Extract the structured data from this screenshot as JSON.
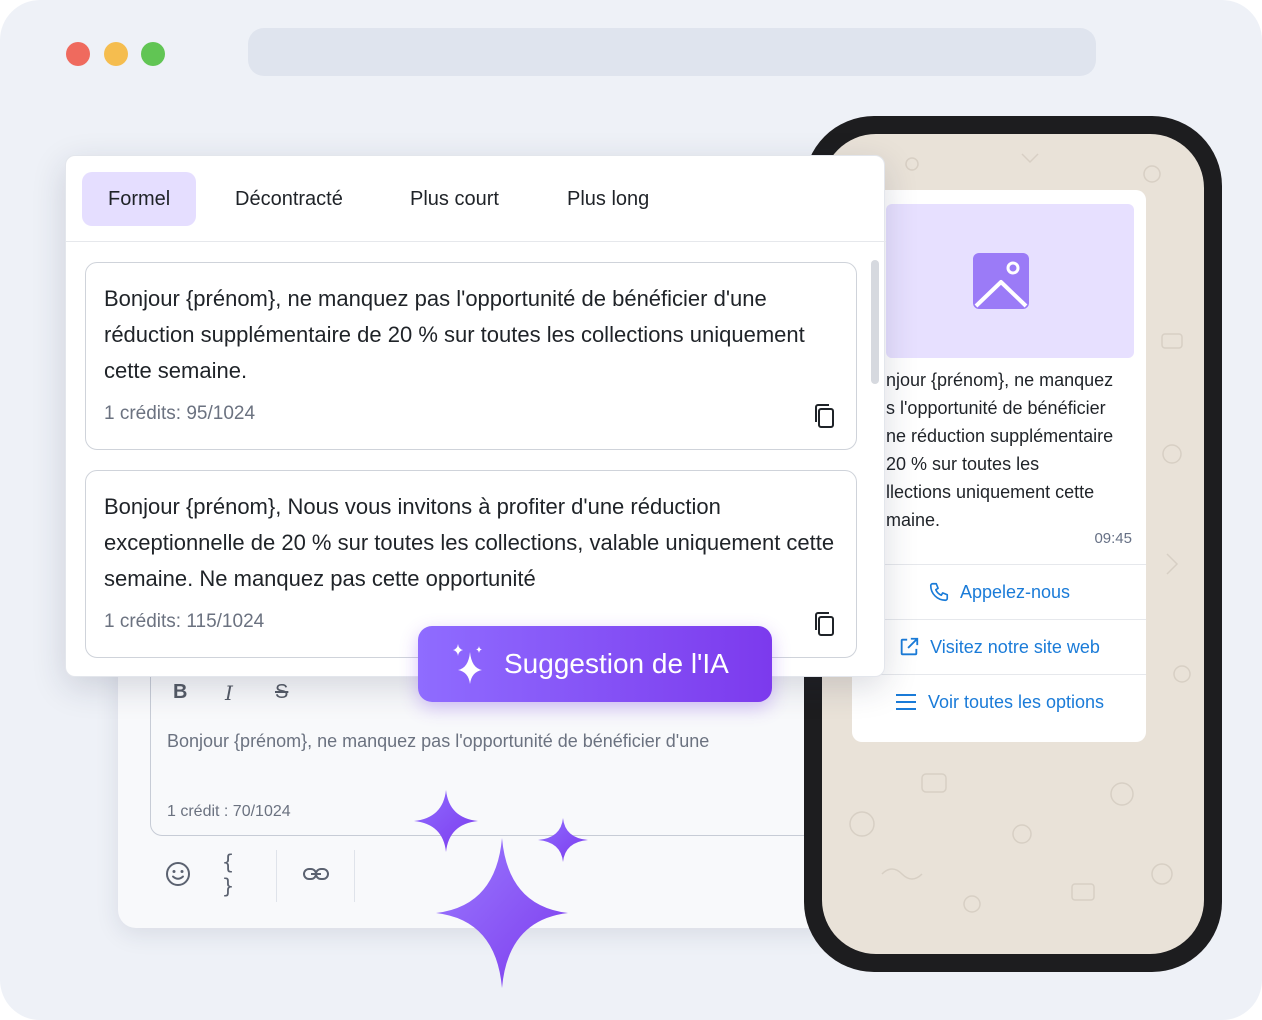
{
  "window": {
    "controls": [
      "close",
      "minimize",
      "maximize"
    ],
    "accent": "#7c3aed"
  },
  "tabs": [
    {
      "label": "Formel",
      "active": true
    },
    {
      "label": "Décontracté",
      "active": false
    },
    {
      "label": "Plus court",
      "active": false
    },
    {
      "label": "Plus long",
      "active": false
    }
  ],
  "suggestions": [
    {
      "text": "Bonjour {prénom}, ne manquez pas l'opportunité de bénéficier d'une réduction supplémentaire de 20 % sur toutes les collections uniquement cette semaine.",
      "credits": "1 crédits: 95/1024"
    },
    {
      "text": "Bonjour {prénom}, Nous vous invitons à profiter d'une réduction exceptionnelle de 20 % sur toutes les collections, valable uniquement cette semaine. Ne manquez pas cette opportunité",
      "credits": "1 crédits: 115/1024"
    }
  ],
  "ai_button": {
    "label": "Suggestion de l'IA",
    "icon": "sparkle-icon"
  },
  "editor": {
    "format": {
      "bold": "B",
      "italic": "I",
      "strike": "S"
    },
    "text": "Bonjour {prénom}, ne manquez pas l'opportunité de bénéficier d'une",
    "credit": "1 crédit : 70/1024",
    "toolbar": {
      "emoji_icon": "smiley-icon",
      "variables": "{ }",
      "link_icon": "link-icon"
    }
  },
  "phone": {
    "media_icon": "image-icon",
    "message_text": "njour {prénom}, ne manquez\ns l'opportunité de bénéficier\nne réduction supplémentaire\n 20 % sur toutes les\nllections uniquement cette\nmaine.",
    "time": "09:45",
    "buttons": [
      {
        "label": "Appelez-nous",
        "icon": "phone-icon"
      },
      {
        "label": "Visitez notre site web",
        "icon": "external-link-icon"
      },
      {
        "label": "Voir toutes les options",
        "icon": "list-icon"
      }
    ],
    "link_color": "#1a7bd8"
  }
}
